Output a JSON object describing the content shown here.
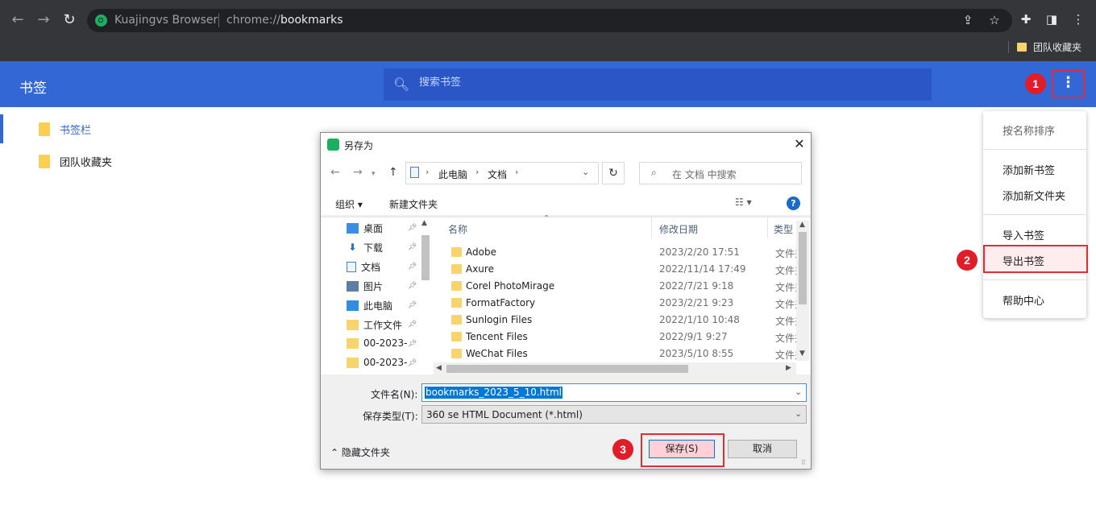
{
  "browser": {
    "site_name": "Kuajingvs Browser",
    "url_prefix": "chrome://",
    "url_page": "bookmarks",
    "bookmark_bar_folder": "团队收藏夹"
  },
  "header": {
    "title": "书签",
    "search_placeholder": "搜索书签"
  },
  "sidebar": {
    "items": [
      {
        "label": "书签栏",
        "active": true
      },
      {
        "label": "团队收藏夹",
        "active": false
      }
    ]
  },
  "menu": {
    "sort": "按名称排序",
    "add_bookmark": "添加新书签",
    "add_folder": "添加新文件夹",
    "import": "导入书签",
    "export": "导出书签",
    "help": "帮助中心"
  },
  "badges": [
    "1",
    "2",
    "3"
  ],
  "dialog": {
    "title": "另存为",
    "path": [
      "此电脑",
      "文档"
    ],
    "search_placeholder": "在 文档 中搜索",
    "organize": "组织",
    "new_folder": "新建文件夹",
    "nav_items": [
      "桌面",
      "下载",
      "文档",
      "图片",
      "此电脑",
      "工作文件",
      "00-2023-",
      "00-2023-"
    ],
    "columns": {
      "name": "名称",
      "date": "修改日期",
      "type": "类型"
    },
    "files": [
      {
        "name": "Adobe",
        "date": "2023/2/20 17:51",
        "type": "文件夹"
      },
      {
        "name": "Axure",
        "date": "2022/11/14 17:49",
        "type": "文件夹"
      },
      {
        "name": "Corel PhotoMirage",
        "date": "2022/7/21 9:18",
        "type": "文件夹"
      },
      {
        "name": "FormatFactory",
        "date": "2023/2/21 9:23",
        "type": "文件夹"
      },
      {
        "name": "Sunlogin Files",
        "date": "2022/1/10 10:48",
        "type": "文件夹"
      },
      {
        "name": "Tencent Files",
        "date": "2022/9/1 9:27",
        "type": "文件夹"
      },
      {
        "name": "WeChat Files",
        "date": "2023/5/10 8:55",
        "type": "文件夹"
      }
    ],
    "filename_label": "文件名(N):",
    "filename": "bookmarks_2023_5_10.html",
    "filetype_label": "保存类型(T):",
    "filetype": "360 se HTML Document (*.html)",
    "hide_folders": "隐藏文件夹",
    "save": "保存(S)",
    "cancel": "取消"
  },
  "colors": {
    "accent": "#3367d6",
    "highlight": "#e12b35",
    "badge": "#e11d2a"
  }
}
